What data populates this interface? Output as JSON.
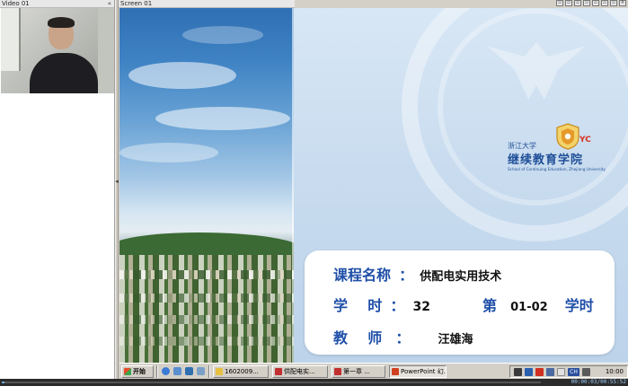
{
  "video_panel": {
    "title": "Video 01",
    "collapse_glyph": "«"
  },
  "screen_panel": {
    "title": "Screen 01"
  },
  "splitter": {
    "arrow": "◂"
  },
  "window_controls": [
    {
      "name": "restore-icon",
      "glyph": "▫"
    },
    {
      "name": "layout-1-icon",
      "glyph": "▫"
    },
    {
      "name": "layout-2-icon",
      "glyph": "▫"
    },
    {
      "name": "layout-3-icon",
      "glyph": "▫"
    },
    {
      "name": "layout-4-icon",
      "glyph": "▫"
    },
    {
      "name": "layout-5-icon",
      "glyph": "▫"
    },
    {
      "name": "layout-6-icon",
      "glyph": "▫"
    },
    {
      "name": "close-icon",
      "glyph": "×"
    }
  ],
  "slide": {
    "logo": {
      "cn_small": "浙江大学",
      "cn_big": "继续教育学院",
      "yc": "YC",
      "en": "School of Continuing Education, Zhejiang University"
    },
    "course": {
      "name_label": "课程名称",
      "name_colon": "：",
      "name_value": "供配电实用技术",
      "hours_label": "学    时",
      "hours_colon": "：",
      "hours_value": "32",
      "chapter_prefix": "第",
      "chapter_value": "01-02",
      "chapter_suffix": "学时",
      "teacher_label": "教    师",
      "teacher_colon": "：",
      "teacher_value": "汪雄海"
    }
  },
  "taskbar": {
    "start_label": "开始",
    "items": [
      {
        "label": "1602009...",
        "icon_color": "#e8c040",
        "active": false
      },
      {
        "label": "供配电实...",
        "icon_color": "#c03030",
        "active": false
      },
      {
        "label": "第一章 ...",
        "icon_color": "#c03030",
        "active": false
      },
      {
        "label": "PowerPoint 幻...",
        "icon_color": "#d04020",
        "active": true
      }
    ],
    "tray_lang": "CH",
    "clock": "10:00"
  },
  "player": {
    "timecode": "00:00:03/00:55:52",
    "progress": 0.001
  },
  "colors": {
    "accent_blue": "#1f4fa8",
    "logo_red": "#d8321d",
    "taskbar_gray": "#d4d0c8"
  }
}
